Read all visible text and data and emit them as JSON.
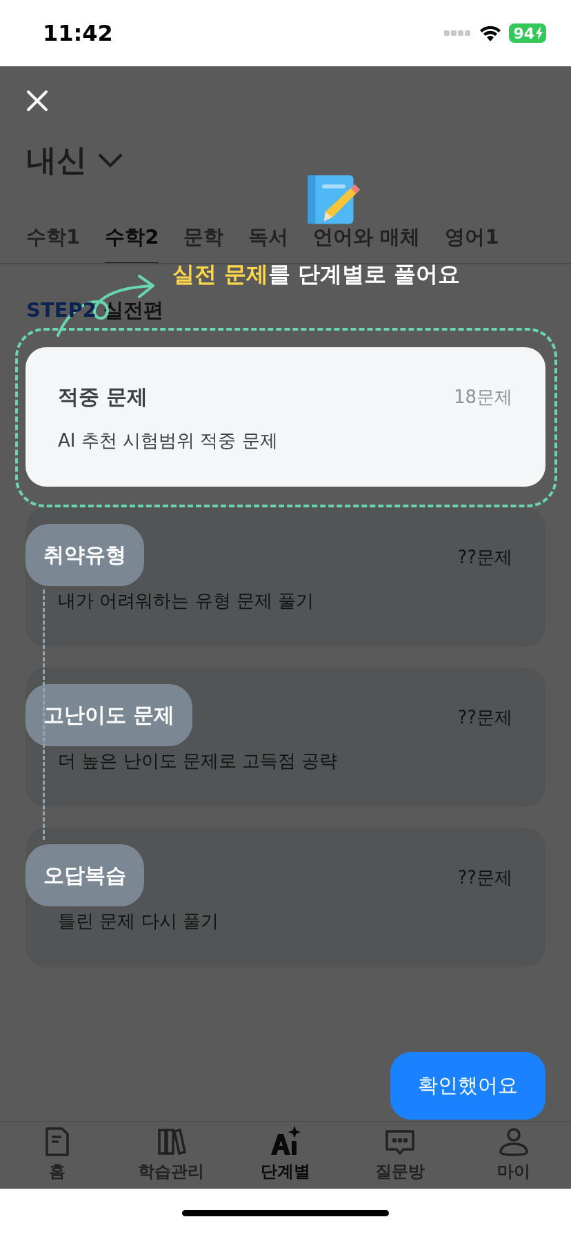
{
  "status_bar": {
    "time": "11:42",
    "battery": "94"
  },
  "header": {
    "title": "내신"
  },
  "tabs": [
    {
      "label": "수학1",
      "selected": false
    },
    {
      "label": "수학2",
      "selected": true
    },
    {
      "label": "문학",
      "selected": false
    },
    {
      "label": "독서",
      "selected": false
    },
    {
      "label": "언어와 매체",
      "selected": false
    },
    {
      "label": "영어1",
      "selected": false
    }
  ],
  "section": {
    "step": "STEP2",
    "title": "실전편"
  },
  "coach": {
    "message": "**실전 문제**를 단계별로 풀어요",
    "confirm_button": "확인했어요"
  },
  "cards": [
    {
      "title": "적중 문제",
      "count": "18문제",
      "description": "AI 추천 시험범위 적중 문제",
      "highlighted": true
    },
    {
      "coach_label": "취약유형",
      "count": "??문제",
      "description": "내가 어려워하는 유형 문제 풀기",
      "highlighted": false
    },
    {
      "coach_label": "고난이도 문제",
      "count": "??문제",
      "description": "더 높은 난이도 문제로 고득점 공략",
      "highlighted": false
    },
    {
      "coach_label": "오답복습",
      "count": "??문제",
      "description": "틀린 문제 다시 풀기",
      "highlighted": false
    }
  ],
  "nav": [
    {
      "label": "홈",
      "selected": false
    },
    {
      "label": "학습관리",
      "selected": false
    },
    {
      "label": "단계별",
      "selected": true
    },
    {
      "label": "질문방",
      "selected": false
    },
    {
      "label": "마이",
      "selected": false
    }
  ]
}
